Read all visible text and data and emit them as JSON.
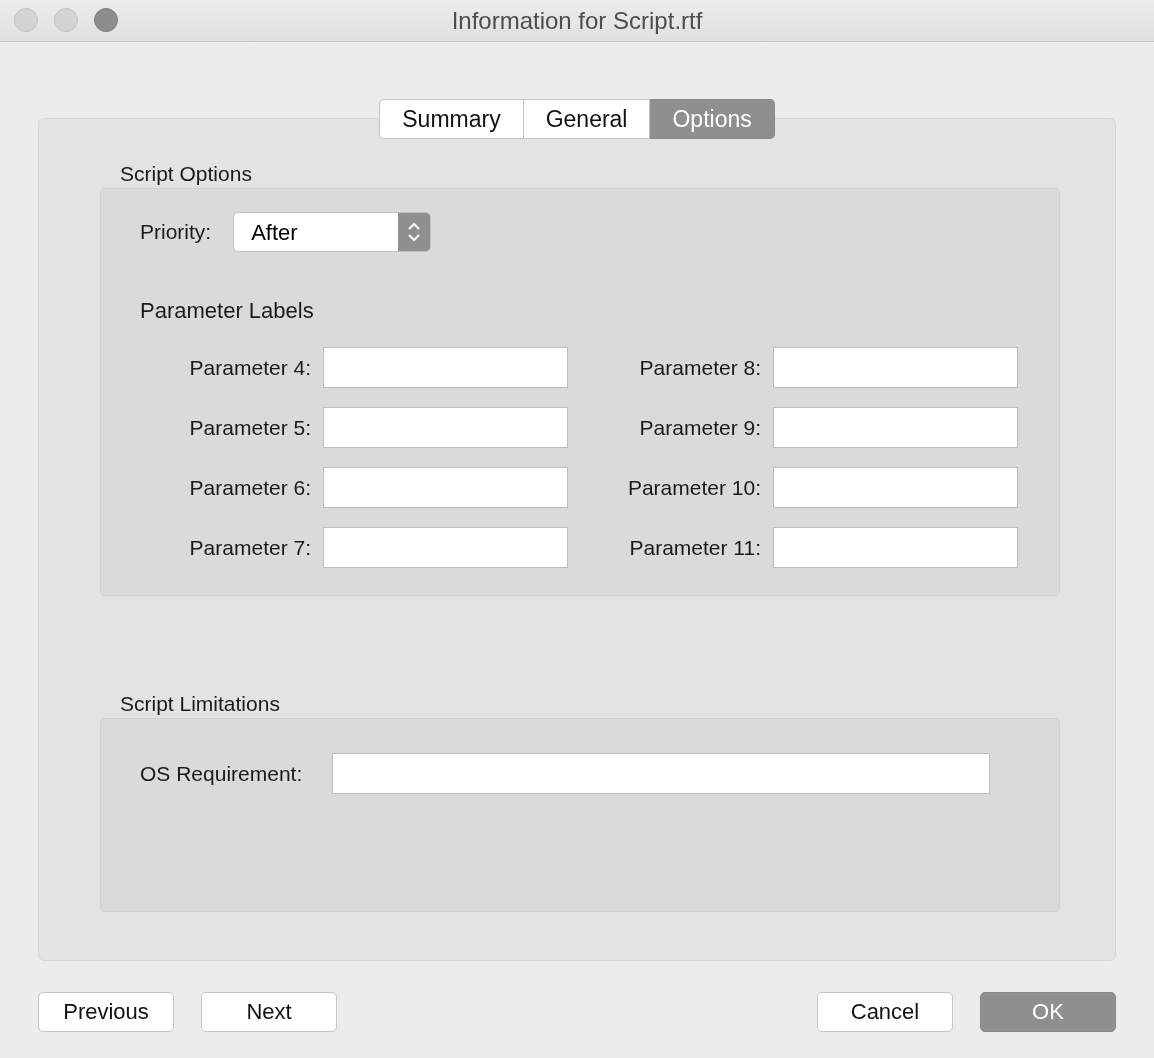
{
  "window": {
    "title": "Information for Script.rtf"
  },
  "tabs": [
    {
      "label": "Summary",
      "selected": false
    },
    {
      "label": "General",
      "selected": false
    },
    {
      "label": "Options",
      "selected": true
    }
  ],
  "script_options": {
    "heading": "Script Options",
    "priority": {
      "label": "Priority:",
      "value": "After"
    },
    "parameter_labels": {
      "heading": "Parameter Labels",
      "columns": [
        {
          "fields": [
            {
              "label": "Parameter 4:"
            },
            {
              "label": "Parameter 5:"
            },
            {
              "label": "Parameter 6:"
            },
            {
              "label": "Parameter 7:"
            }
          ]
        },
        {
          "fields": [
            {
              "label": "Parameter 8:"
            },
            {
              "label": "Parameter 9:"
            },
            {
              "label": "Parameter 10:"
            },
            {
              "label": "Parameter 11:"
            }
          ]
        }
      ]
    }
  },
  "script_limitations": {
    "heading": "Script Limitations",
    "os_requirement": {
      "label": "OS Requirement:"
    }
  },
  "buttons_left": [
    {
      "label": "Previous",
      "default": false
    },
    {
      "label": "Next",
      "default": false
    }
  ],
  "buttons_right": [
    {
      "label": "Cancel",
      "default": false
    },
    {
      "label": "OK",
      "default": true
    }
  ]
}
